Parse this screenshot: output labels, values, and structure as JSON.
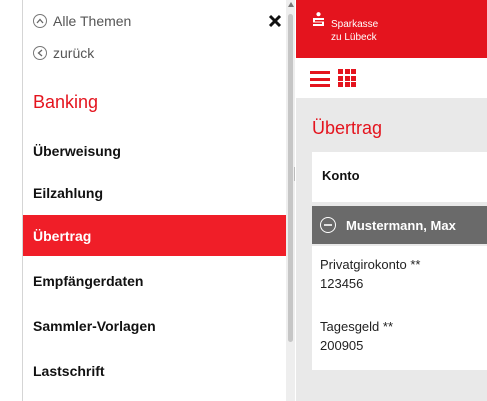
{
  "menu": {
    "back_all_label": "Alle Themen",
    "back_label": "zurück",
    "section_title": "Banking",
    "items": [
      {
        "label": "Überweisung",
        "active": false
      },
      {
        "label": "Eilzahlung",
        "active": false
      },
      {
        "label": "Übertrag",
        "active": true
      },
      {
        "label": "Empfängerdaten",
        "active": false
      },
      {
        "label": "Sammler-Vorlagen",
        "active": false
      },
      {
        "label": "Lastschrift",
        "active": false
      }
    ]
  },
  "app": {
    "brand_name": "Sparkasse\nzu Lübeck",
    "brand_color": "#e4141e",
    "page_title": "Übertrag",
    "konto_label": "Konto",
    "account_owner": "Mustermann, Max",
    "accounts": [
      {
        "name": "Privatgirokonto **",
        "number": "123456"
      },
      {
        "name": "Tagesgeld **",
        "number": "200905"
      }
    ]
  },
  "icons": [
    "chevron-up-circle-icon",
    "chevron-left-circle-icon",
    "close-icon",
    "sparkasse-logo-icon",
    "hamburger-menu-icon",
    "grid-icon",
    "minus-circle-icon"
  ]
}
